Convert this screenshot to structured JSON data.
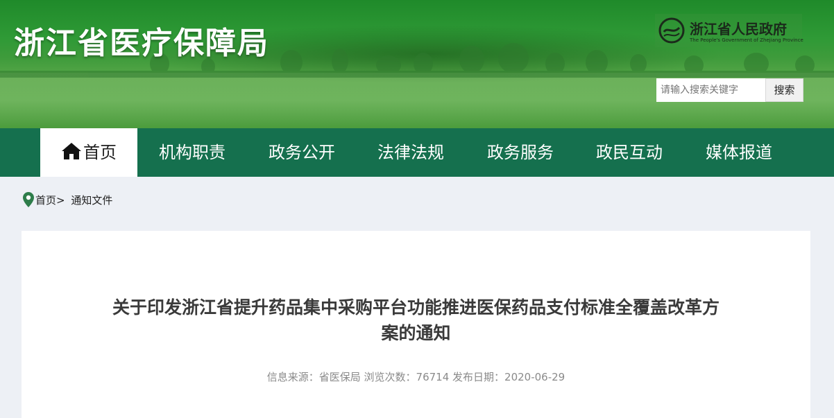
{
  "header": {
    "site_title": "浙江省医疗保障局",
    "gov_logo": {
      "name": "浙江省人民政府",
      "name_en": "The People's Government of Zhejiang Province",
      "icon": "zhejiang-emblem-icon"
    },
    "search": {
      "placeholder": "请输入搜索关键字",
      "button_label": "搜索"
    }
  },
  "nav": {
    "items": [
      {
        "label": "首页",
        "active": true,
        "icon": "home-icon"
      },
      {
        "label": "机构职责"
      },
      {
        "label": "政务公开"
      },
      {
        "label": "法律法规"
      },
      {
        "label": "政务服务"
      },
      {
        "label": "政民互动"
      },
      {
        "label": "媒体报道"
      }
    ]
  },
  "breadcrumb": {
    "icon": "location-pin-icon",
    "home": "首页",
    "separator": ">",
    "current": "通知文件"
  },
  "article": {
    "title_line1": "关于印发浙江省提升药品集中采购平台功能推进医保药品支付标准全覆盖改革方",
    "title_line2": "案的通知",
    "meta": "信息来源：省医保局 浏览次数：76714 发布日期：2020-06-29"
  },
  "colors": {
    "nav_bg": "#15704e",
    "page_bg": "#edf0f5",
    "banner_green": "#3e9b3b"
  }
}
